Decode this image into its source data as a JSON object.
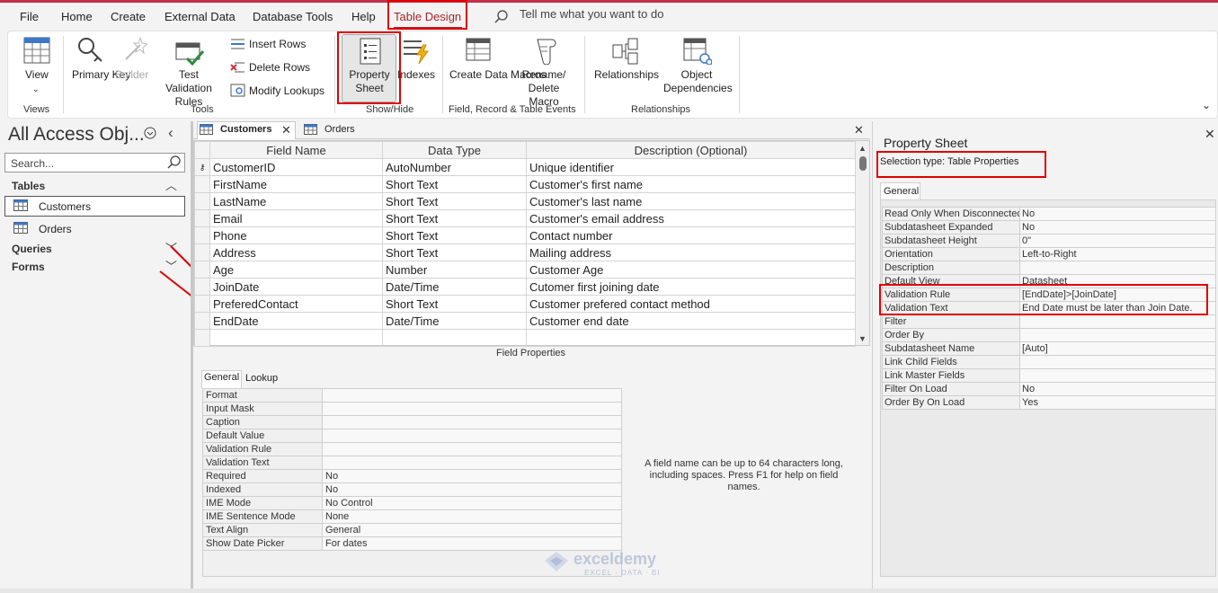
{
  "menu": [
    "File",
    "Home",
    "Create",
    "External Data",
    "Database Tools",
    "Help",
    "Table Design"
  ],
  "tell_me": "Tell me what you want to do",
  "ribbon": {
    "view": {
      "label": "View",
      "group": "Views"
    },
    "tools": {
      "primary_key": "Primary Key",
      "builder": "Builder",
      "test_validation": "Test Validation Rules",
      "insert_rows": "Insert Rows",
      "delete_rows": "Delete Rows",
      "modify_lookups": "Modify Lookups",
      "group": "Tools"
    },
    "showhide": {
      "property_sheet": "Property Sheet",
      "indexes": "Indexes",
      "group": "Show/Hide"
    },
    "events": {
      "create_data_macros": "Create Data Macros",
      "rename_delete_macro": "Rename/ Delete Macro",
      "group": "Field, Record & Table Events"
    },
    "relationships": {
      "relationships": "Relationships",
      "object_dependencies": "Object Dependencies",
      "group": "Relationships"
    }
  },
  "nav": {
    "title": "All Access Obj...",
    "search_placeholder": "Search...",
    "sections": [
      {
        "label": "Tables",
        "items": [
          "Customers",
          "Orders"
        ]
      },
      {
        "label": "Queries"
      },
      {
        "label": "Forms"
      }
    ]
  },
  "doc_tabs": [
    "Customers",
    "Orders"
  ],
  "design_grid": {
    "headers": [
      "Field Name",
      "Data Type",
      "Description (Optional)"
    ],
    "rows": [
      [
        "CustomerID",
        "AutoNumber",
        "Unique identifier"
      ],
      [
        "FirstName",
        "Short Text",
        "Customer's first name"
      ],
      [
        "LastName",
        "Short Text",
        "Customer's last name"
      ],
      [
        "Email",
        "Short Text",
        "Customer's email address"
      ],
      [
        "Phone",
        "Short Text",
        "Contact number"
      ],
      [
        "Address",
        "Short Text",
        "Mailing address"
      ],
      [
        "Age",
        "Number",
        "Customer Age"
      ],
      [
        "JoinDate",
        "Date/Time",
        "Cutomer first joining  date"
      ],
      [
        "PreferedContact",
        "Short Text",
        "Customer prefered contact method"
      ],
      [
        "EndDate",
        "Date/Time",
        "Customer end date"
      ]
    ]
  },
  "field_properties": {
    "title": "Field Properties",
    "tabs": [
      "General",
      "Lookup"
    ],
    "rows": [
      [
        "Format",
        ""
      ],
      [
        "Input Mask",
        ""
      ],
      [
        "Caption",
        ""
      ],
      [
        "Default Value",
        ""
      ],
      [
        "Validation Rule",
        ""
      ],
      [
        "Validation Text",
        ""
      ],
      [
        "Required",
        "No"
      ],
      [
        "Indexed",
        "No"
      ],
      [
        "IME Mode",
        "No Control"
      ],
      [
        "IME Sentence Mode",
        "None"
      ],
      [
        "Text Align",
        "General"
      ],
      [
        "Show Date Picker",
        "For dates"
      ]
    ],
    "help": "A field name can be up to 64 characters long, including spaces. Press F1 for help on field names."
  },
  "property_sheet": {
    "title": "Property Sheet",
    "selection_type": "Selection type:  Table Properties",
    "tab": "General",
    "rows": [
      [
        "Read Only When Disconnected",
        "No"
      ],
      [
        "Subdatasheet Expanded",
        "No"
      ],
      [
        "Subdatasheet Height",
        "0\""
      ],
      [
        "Orientation",
        "Left-to-Right"
      ],
      [
        "Description",
        ""
      ],
      [
        "Default View",
        "Datasheet"
      ],
      [
        "Validation Rule",
        "[EndDate]>[JoinDate]"
      ],
      [
        "Validation Text",
        "End Date must be later than  Join Date."
      ],
      [
        "Filter",
        ""
      ],
      [
        "Order By",
        ""
      ],
      [
        "Subdatasheet Name",
        "[Auto]"
      ],
      [
        "Link Child Fields",
        ""
      ],
      [
        "Link Master Fields",
        ""
      ],
      [
        "Filter On Load",
        "No"
      ],
      [
        "Order By On Load",
        "Yes"
      ]
    ]
  },
  "watermark": {
    "name": "exceldemy",
    "tagline": "EXCEL · DATA · BI"
  },
  "colors": {
    "accent": "#a4262c",
    "highlight": "#e00000"
  }
}
